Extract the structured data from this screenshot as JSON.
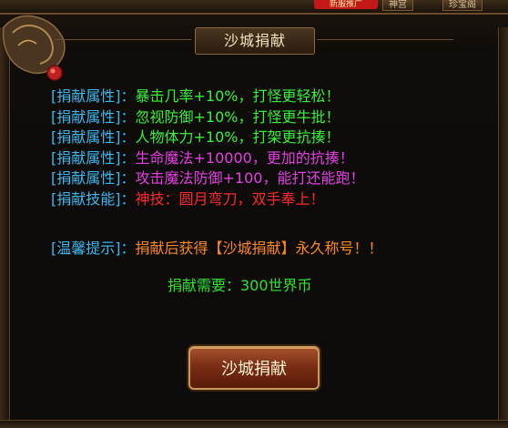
{
  "top_bar": {
    "badge": "新服推广",
    "tab1": "神宫",
    "tab2": "珍宝阁"
  },
  "dialog": {
    "title": "沙城捐献",
    "attributes": [
      {
        "label": "[捐献属性]：",
        "text": "暴击几率+10%，打怪更轻松！",
        "color": "#37f037"
      },
      {
        "label": "[捐献属性]：",
        "text": "忽视防御+10%，打怪更牛批！",
        "color": "#37f037"
      },
      {
        "label": "[捐献属性]：",
        "text": "人物体力+10%，打架更抗揍！",
        "color": "#37f037"
      },
      {
        "label": "[捐献属性]：",
        "text": "生命魔法+10000，更加的抗揍！",
        "color": "#e33fe3"
      },
      {
        "label": "[捐献属性]：",
        "text": "攻击魔法防御+100，能打还能跑！",
        "color": "#e33fe3"
      },
      {
        "label": "[捐献技能]：",
        "text": "神技：圆月弯刀，双手奉上！",
        "color": "#ff2a2a"
      }
    ],
    "tip": {
      "label": "[温馨提示]：",
      "text": "捐献后获得【沙城捐献】永久称号！！",
      "color": "#ff8a1a"
    },
    "requirement": "捐献需要：300世界币",
    "button_label": "沙城捐献"
  },
  "colors": {
    "label": "#3bb8f0",
    "requirement": "#2fe22f"
  },
  "icons": [
    "dragon-ornament-icon"
  ]
}
